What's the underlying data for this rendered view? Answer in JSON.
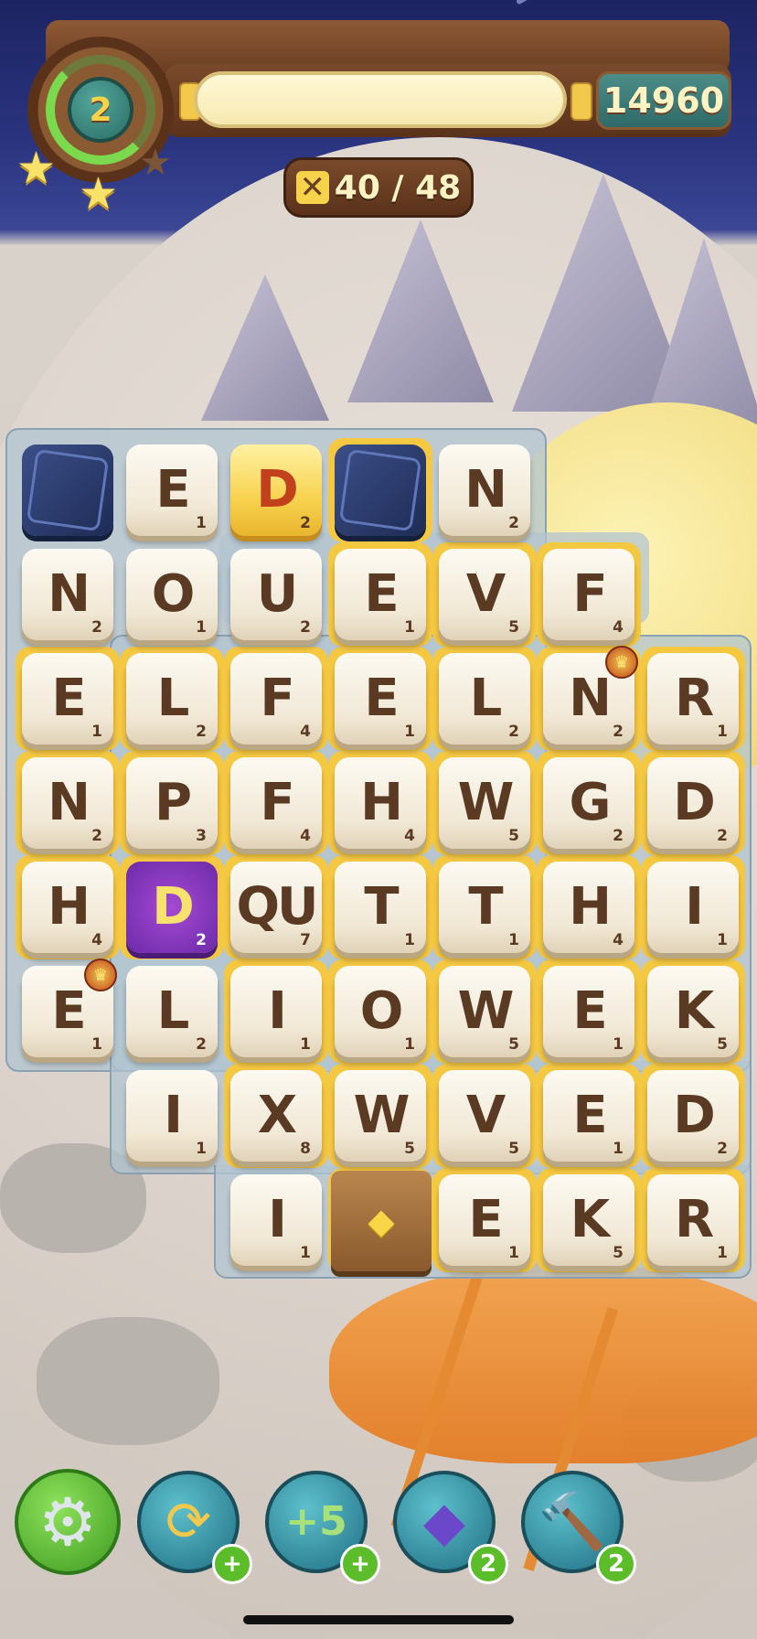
{
  "hud": {
    "level": "2",
    "score": "14960",
    "moves": "40 / 48"
  },
  "board": {
    "rows": [
      [
        {
          "t": "stone"
        },
        {
          "t": "tile",
          "l": "E",
          "p": "1"
        },
        {
          "t": "gold",
          "l": "D",
          "p": "2"
        },
        {
          "t": "stone"
        },
        {
          "t": "tile",
          "l": "N",
          "p": "2"
        },
        null,
        null
      ],
      [
        {
          "t": "tile",
          "l": "N",
          "p": "2"
        },
        {
          "t": "tile",
          "l": "O",
          "p": "1"
        },
        {
          "t": "tile",
          "l": "U",
          "p": "2"
        },
        {
          "t": "tile",
          "l": "E",
          "p": "1"
        },
        {
          "t": "tile",
          "l": "V",
          "p": "5"
        },
        {
          "t": "tile",
          "l": "F",
          "p": "4"
        },
        null
      ],
      [
        {
          "t": "tile",
          "l": "E",
          "p": "1"
        },
        {
          "t": "tile",
          "l": "L",
          "p": "2"
        },
        {
          "t": "tile",
          "l": "F",
          "p": "4"
        },
        {
          "t": "tile",
          "l": "E",
          "p": "1"
        },
        {
          "t": "tile",
          "l": "L",
          "p": "2"
        },
        {
          "t": "tile",
          "l": "N",
          "p": "2",
          "crown": true
        },
        {
          "t": "tile",
          "l": "R",
          "p": "1"
        }
      ],
      [
        {
          "t": "tile",
          "l": "N",
          "p": "2"
        },
        {
          "t": "tile",
          "l": "P",
          "p": "3"
        },
        {
          "t": "tile",
          "l": "F",
          "p": "4"
        },
        {
          "t": "tile",
          "l": "H",
          "p": "4"
        },
        {
          "t": "tile",
          "l": "W",
          "p": "5"
        },
        {
          "t": "tile",
          "l": "G",
          "p": "2"
        },
        {
          "t": "tile",
          "l": "D",
          "p": "2"
        }
      ],
      [
        {
          "t": "tile",
          "l": "H",
          "p": "4"
        },
        {
          "t": "purple",
          "l": "D",
          "p": "2"
        },
        {
          "t": "tile",
          "l": "QU",
          "p": "7"
        },
        {
          "t": "tile",
          "l": "T",
          "p": "1"
        },
        {
          "t": "tile",
          "l": "T",
          "p": "1"
        },
        {
          "t": "tile",
          "l": "H",
          "p": "4"
        },
        {
          "t": "tile",
          "l": "I",
          "p": "1"
        }
      ],
      [
        {
          "t": "tile",
          "l": "E",
          "p": "1",
          "crown": true
        },
        {
          "t": "tile",
          "l": "L",
          "p": "2"
        },
        {
          "t": "tile",
          "l": "I",
          "p": "1"
        },
        {
          "t": "tile",
          "l": "O",
          "p": "1"
        },
        {
          "t": "tile",
          "l": "W",
          "p": "5"
        },
        {
          "t": "tile",
          "l": "E",
          "p": "1"
        },
        {
          "t": "tile",
          "l": "K",
          "p": "5"
        }
      ],
      [
        null,
        {
          "t": "tile",
          "l": "I",
          "p": "1"
        },
        {
          "t": "tile",
          "l": "X",
          "p": "8"
        },
        {
          "t": "tile",
          "l": "W",
          "p": "5"
        },
        {
          "t": "tile",
          "l": "V",
          "p": "5"
        },
        {
          "t": "tile",
          "l": "E",
          "p": "1"
        },
        {
          "t": "tile",
          "l": "D",
          "p": "2"
        }
      ],
      [
        null,
        null,
        {
          "t": "tile",
          "l": "I",
          "p": "1"
        },
        {
          "t": "trap"
        },
        {
          "t": "tile",
          "l": "E",
          "p": "1"
        },
        {
          "t": "tile",
          "l": "K",
          "p": "5"
        },
        {
          "t": "tile",
          "l": "R",
          "p": "1"
        }
      ]
    ]
  },
  "toolbar": {
    "settings_icon": "gear-icon",
    "shuffle_icon": "shuffle-icon",
    "plus5_icon": "plus-five-icon",
    "plus5_label": "+5",
    "dice_icon": "dice-icon",
    "hammer_icon": "hammer-icon",
    "shuffle_badge": "+",
    "plus5_badge": "+",
    "dice_badge": "2",
    "hammer_badge": "2"
  },
  "colors": {
    "tile": "#f4ecdc",
    "tile_letter": "#5a3a22",
    "gold_tile": "#f7d24f",
    "highlight": "#f5c842",
    "purple_tile": "#8a3bc4",
    "badge_green": "#5bbd2a"
  }
}
